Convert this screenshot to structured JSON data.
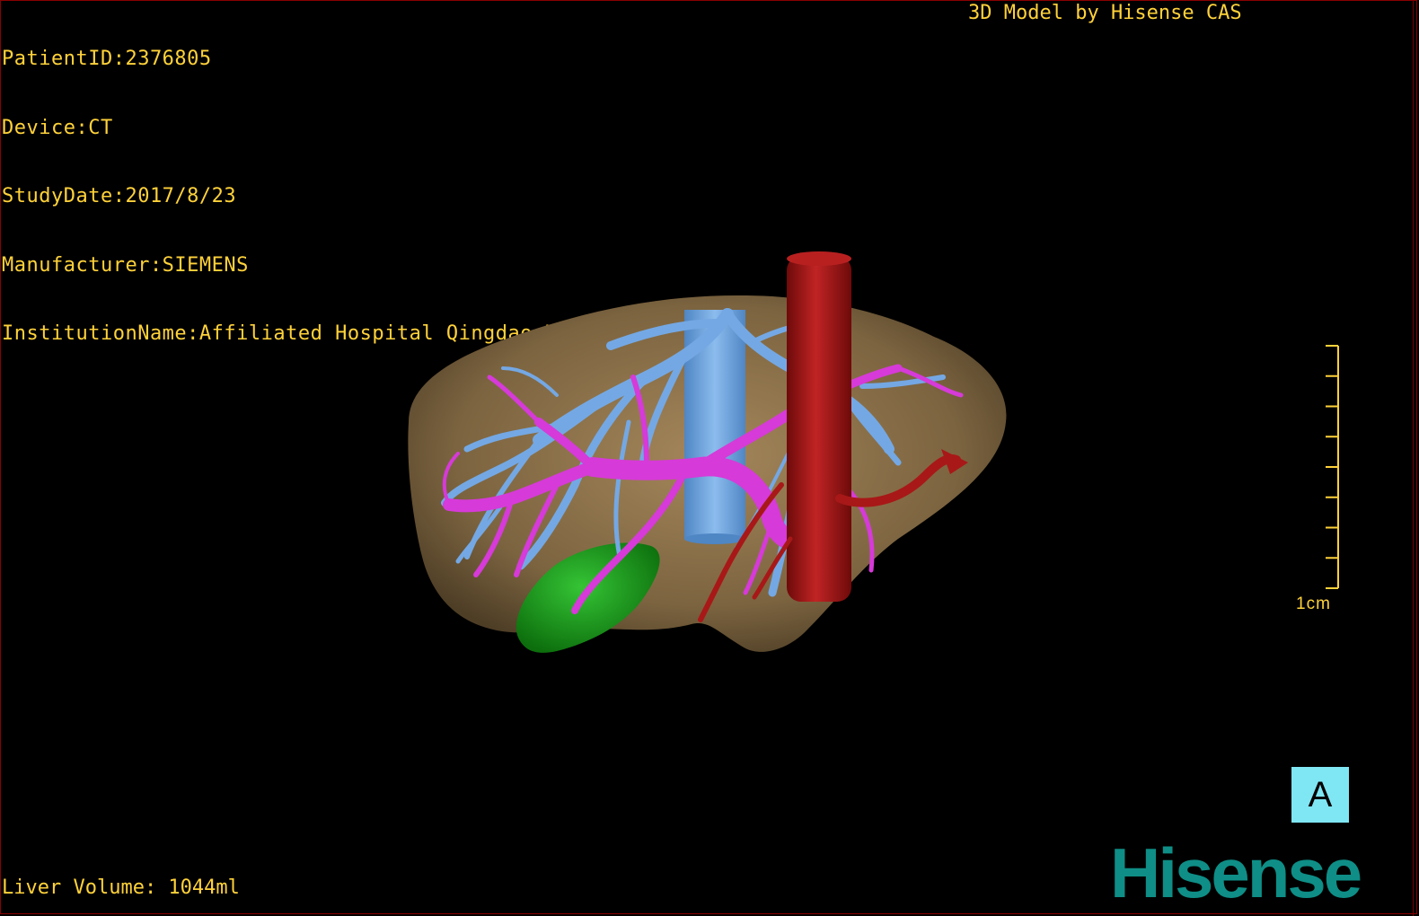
{
  "overlay": {
    "patient_id": "PatientID:2376805",
    "device": "Device:CT",
    "study_date": "StudyDate:2017/8/23",
    "manufacturer": "Manufacturer:SIEMENS",
    "institution": "InstitutionName:Affiliated Hospital Qingdao University-C"
  },
  "brand_caption": "3D Model by Hisense CAS",
  "liver_volume": "Liver Volume: 1044ml",
  "scale_bar": {
    "label": "1cm"
  },
  "view_orientation": "A",
  "logo_text": "Hisense",
  "colors": {
    "overlay_text": "#ffd23a",
    "liver": "#8a7048",
    "hepatic_vein": "#6ea4e0",
    "portal_vein": "#d23ad8",
    "artery": "#a81818",
    "gallbladder": "#1a9c1a",
    "orientation_box": "#7fe6f4",
    "logo": "#0e8e86"
  }
}
